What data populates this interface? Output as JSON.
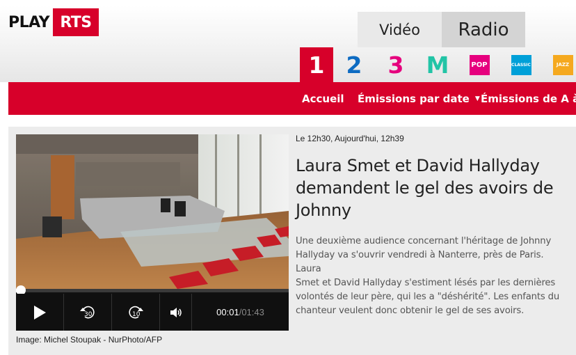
{
  "brand": {
    "play": "PLAY",
    "rts": "RTS"
  },
  "mode_tabs": [
    {
      "label": "Vidéo",
      "selected": false
    },
    {
      "label": "Radio",
      "selected": true
    }
  ],
  "channels": [
    {
      "label": "1",
      "selected": true,
      "color": "#d7002a"
    },
    {
      "label": "2",
      "color": "#0d6bc2"
    },
    {
      "label": "3",
      "color": "#e5007d"
    },
    {
      "label": "M",
      "color": "#22c4a6"
    },
    {
      "label": "POP",
      "color": "#e6007e"
    },
    {
      "label": "CLASSIC",
      "color": "#00a0d8"
    },
    {
      "label": "JAZZ",
      "color": "#f5a91f"
    }
  ],
  "nav": {
    "home": "Accueil",
    "by_date": "Émissions par date",
    "a_to_z": "Émissions de A à Z"
  },
  "article": {
    "meta": "Le 12h30, Aujourd'hui, 12h39",
    "title_lines": [
      "Laura Smet et David Hallyday",
      "demandent le gel des avoirs de",
      "Johnny"
    ],
    "description_lines": [
      "Une deuxième audience concernant l'héritage de Johnny",
      "Hallyday va s'ouvrir vendredi à Nanterre, près de Paris. Laura",
      "Smet et David Hallyday s'estiment lésés par les dernières",
      "volontés de leur père, qui les a \"déshérité\". Les enfants du",
      "chanteur veulent donc obtenir le gel de ses avoirs."
    ],
    "caption": "Image: Michel Stoupak - NurPhoto/AFP"
  },
  "player": {
    "current_time": "00:01",
    "separator": " / ",
    "duration": "01:43",
    "progress_fraction": 0.01,
    "rewind_label": "30",
    "forward_label": "10"
  },
  "colors": {
    "accent": "#d7002a"
  }
}
